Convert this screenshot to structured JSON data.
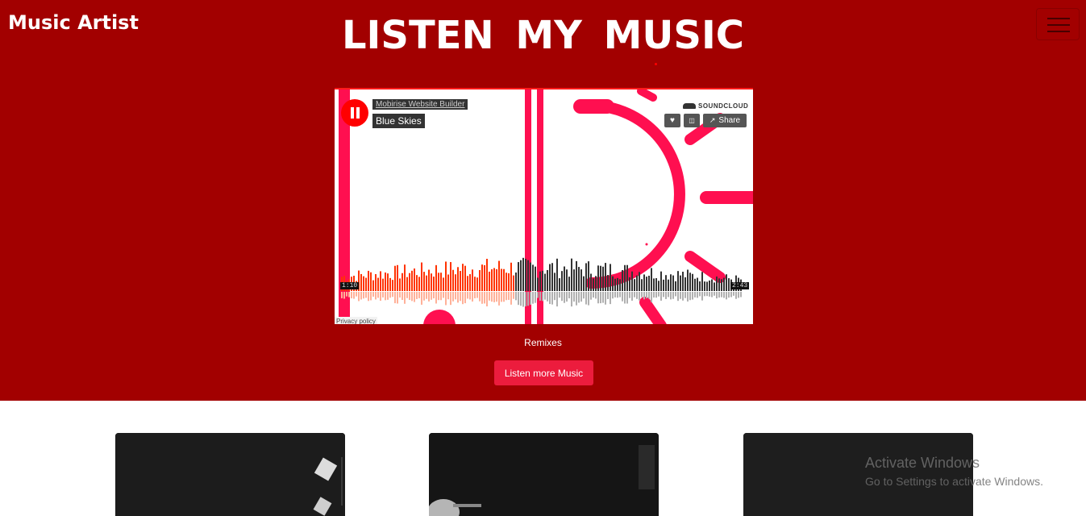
{
  "navbar": {
    "brand": "Music Artist"
  },
  "hero": {
    "title": "LISTEN MY MUSIC",
    "caption": "Remixes",
    "cta_label": "Listen more Music"
  },
  "player": {
    "artist": "Mobirise Website Builder",
    "track": "Blue Skies",
    "brand": "SOUNDCLOUD",
    "share_label": "Share",
    "elapsed": "1:10",
    "duration": "2:43",
    "progress": 0.43,
    "privacy_label": "Privacy policy"
  },
  "windows_notice": {
    "title": "Activate Windows",
    "subtitle": "Go to Settings to activate Windows."
  },
  "colors": {
    "hero_bg": "#a20000",
    "cta_bg": "#ec1c3d",
    "wave_played": "#ff3300",
    "wave_unplayed": "#333333",
    "art_pink": "#ff0f50"
  }
}
